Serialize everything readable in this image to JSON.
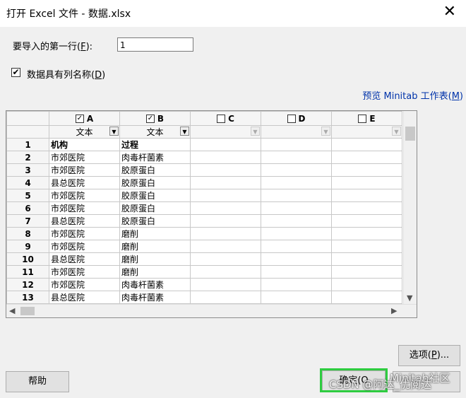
{
  "window": {
    "title": "打开 Excel 文件 - 数据.xlsx",
    "close_glyph": "✕"
  },
  "first_row": {
    "label": "要导入的第一行(",
    "mnemonic": "F",
    "label_end": "):",
    "value": "1"
  },
  "header_checkbox": {
    "checked": true,
    "label": "数据具有列名称(",
    "mnemonic": "D",
    "label_end": ")"
  },
  "preview_link": {
    "label": "预览 Minitab 工作表(",
    "mnemonic": "M",
    "label_end": ")"
  },
  "grid": {
    "columns": [
      {
        "letter": "A",
        "checked": true,
        "type": "文本"
      },
      {
        "letter": "B",
        "checked": true,
        "type": "文本"
      },
      {
        "letter": "C",
        "checked": false,
        "type": ""
      },
      {
        "letter": "D",
        "checked": false,
        "type": ""
      },
      {
        "letter": "E",
        "checked": false,
        "type": ""
      }
    ],
    "rows": [
      {
        "n": "1",
        "a": "机构",
        "b": "过程"
      },
      {
        "n": "2",
        "a": "市郊医院",
        "b": "肉毒杆菌素"
      },
      {
        "n": "3",
        "a": "市郊医院",
        "b": "胶原蛋白"
      },
      {
        "n": "4",
        "a": "县总医院",
        "b": "胶原蛋白"
      },
      {
        "n": "5",
        "a": "市郊医院",
        "b": "胶原蛋白"
      },
      {
        "n": "6",
        "a": "市郊医院",
        "b": "胶原蛋白"
      },
      {
        "n": "7",
        "a": "县总医院",
        "b": "胶原蛋白"
      },
      {
        "n": "8",
        "a": "市郊医院",
        "b": "磨削"
      },
      {
        "n": "9",
        "a": "市郊医院",
        "b": "磨削"
      },
      {
        "n": "10",
        "a": "县总医院",
        "b": "磨削"
      },
      {
        "n": "11",
        "a": "市郊医院",
        "b": "磨削"
      },
      {
        "n": "12",
        "a": "市郊医院",
        "b": "肉毒杆菌素"
      },
      {
        "n": "13",
        "a": "县总医院",
        "b": "肉毒杆菌素"
      }
    ]
  },
  "buttons": {
    "options": {
      "label": "选项(",
      "mnemonic": "P",
      "label_end": ")..."
    },
    "help": "帮助",
    "ok": {
      "label": "确定(O",
      "mnemonic": "",
      "label_end": ""
    }
  },
  "watermark": {
    "line1": "Minitab社区",
    "line2": "CSDN @阿达_优阅达"
  }
}
